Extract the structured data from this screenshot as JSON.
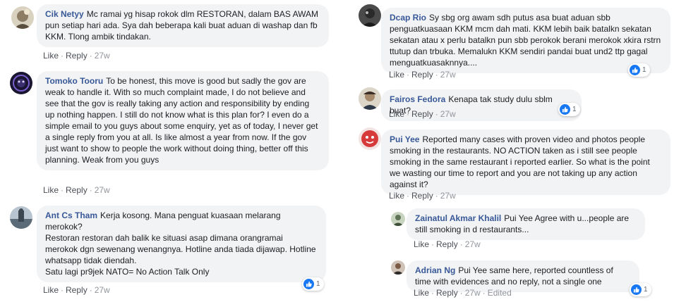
{
  "colors": {
    "name": "#385898",
    "bubble": "#f2f3f5",
    "like_blue": "#1877f2",
    "meta": "#90949c"
  },
  "actions": {
    "like": "Like",
    "reply": "Reply",
    "separator": "·"
  },
  "left_comments": [
    {
      "author": "Cik Netyy",
      "text": "Mc ramai yg hisap rokok dlm RESTORAN, dalam BAS AWAM pun setiap hari ada. Sya dah beberapa kali buat aduan di washap dan fb KKM. Tlong ambik tindakan.",
      "time": "27w"
    },
    {
      "author": "Tomoko Tooru",
      "text": "To be honest, this move is good but sadly the gov are weak to handle it. With so much complaint made, I do not believe and see that the gov is really taking any action and responsibility by ending up nothing happen. I still do not know what is this plan for? I even do a simple email to you guys about some enquiry, yet as of today, I never get a single reply from you at all. Is like almost a year from now. If the gov just want to show to people the work without doing thing, better off this planning. Weak from you guys",
      "time": "27w"
    },
    {
      "author": "Ant Cs Tham",
      "text": "Kerja kosong. Mana penguat kuasaan melarang merokok?\nRestoran restoran dah balik ke situasi asap dimana orangramai merokok dgn sewenang wenangnya. Hotline anda tiada dijawap. Hotline whatsapp tidak diendah.\nSatu lagi pr9jek NATO= No Action Talk Only",
      "time": "27w",
      "reactions": "1"
    }
  ],
  "right_comments": [
    {
      "author": "Dcap Rio",
      "text": "Sy sbg org awam sdh putus asa buat aduan sbb penguatkuasaan KKM mcm dah mati. KKM lebih baik batalkn sekatan sekatan atau x perlu batalkn pun sbb perokok berani merokok xkira rstrn ttutup dan trbuka. Memalukn KKM sendiri pandai buat und2 ttp gagal menguatkuasaknnya....",
      "time": "27w",
      "reactions": "1"
    },
    {
      "author": "Fairos Fedora",
      "text": "Kenapa tak study dulu sblm buat?",
      "time": "27w",
      "reactions": "1"
    },
    {
      "author": "Pui Yee",
      "text": "Reported many cases with proven video and photos people smoking in the restaurants. NO ACTION taken as i still see people smoking in the same restaurant i reported earlier. So what is the point we wasting our time to report and you are not taking up any action against it?",
      "time": "27w"
    },
    {
      "author": "Zainatul Akmar Khalil",
      "text": "Pui Yee Agree with u...people are still smoking in d restaurants...",
      "time": "27w"
    },
    {
      "author": "Adrian Ng",
      "text": "Pui Yee same here, reported countless of time with evidences and no reply, not a single one",
      "time": "27w",
      "edited": "Edited",
      "reactions": "1"
    }
  ]
}
